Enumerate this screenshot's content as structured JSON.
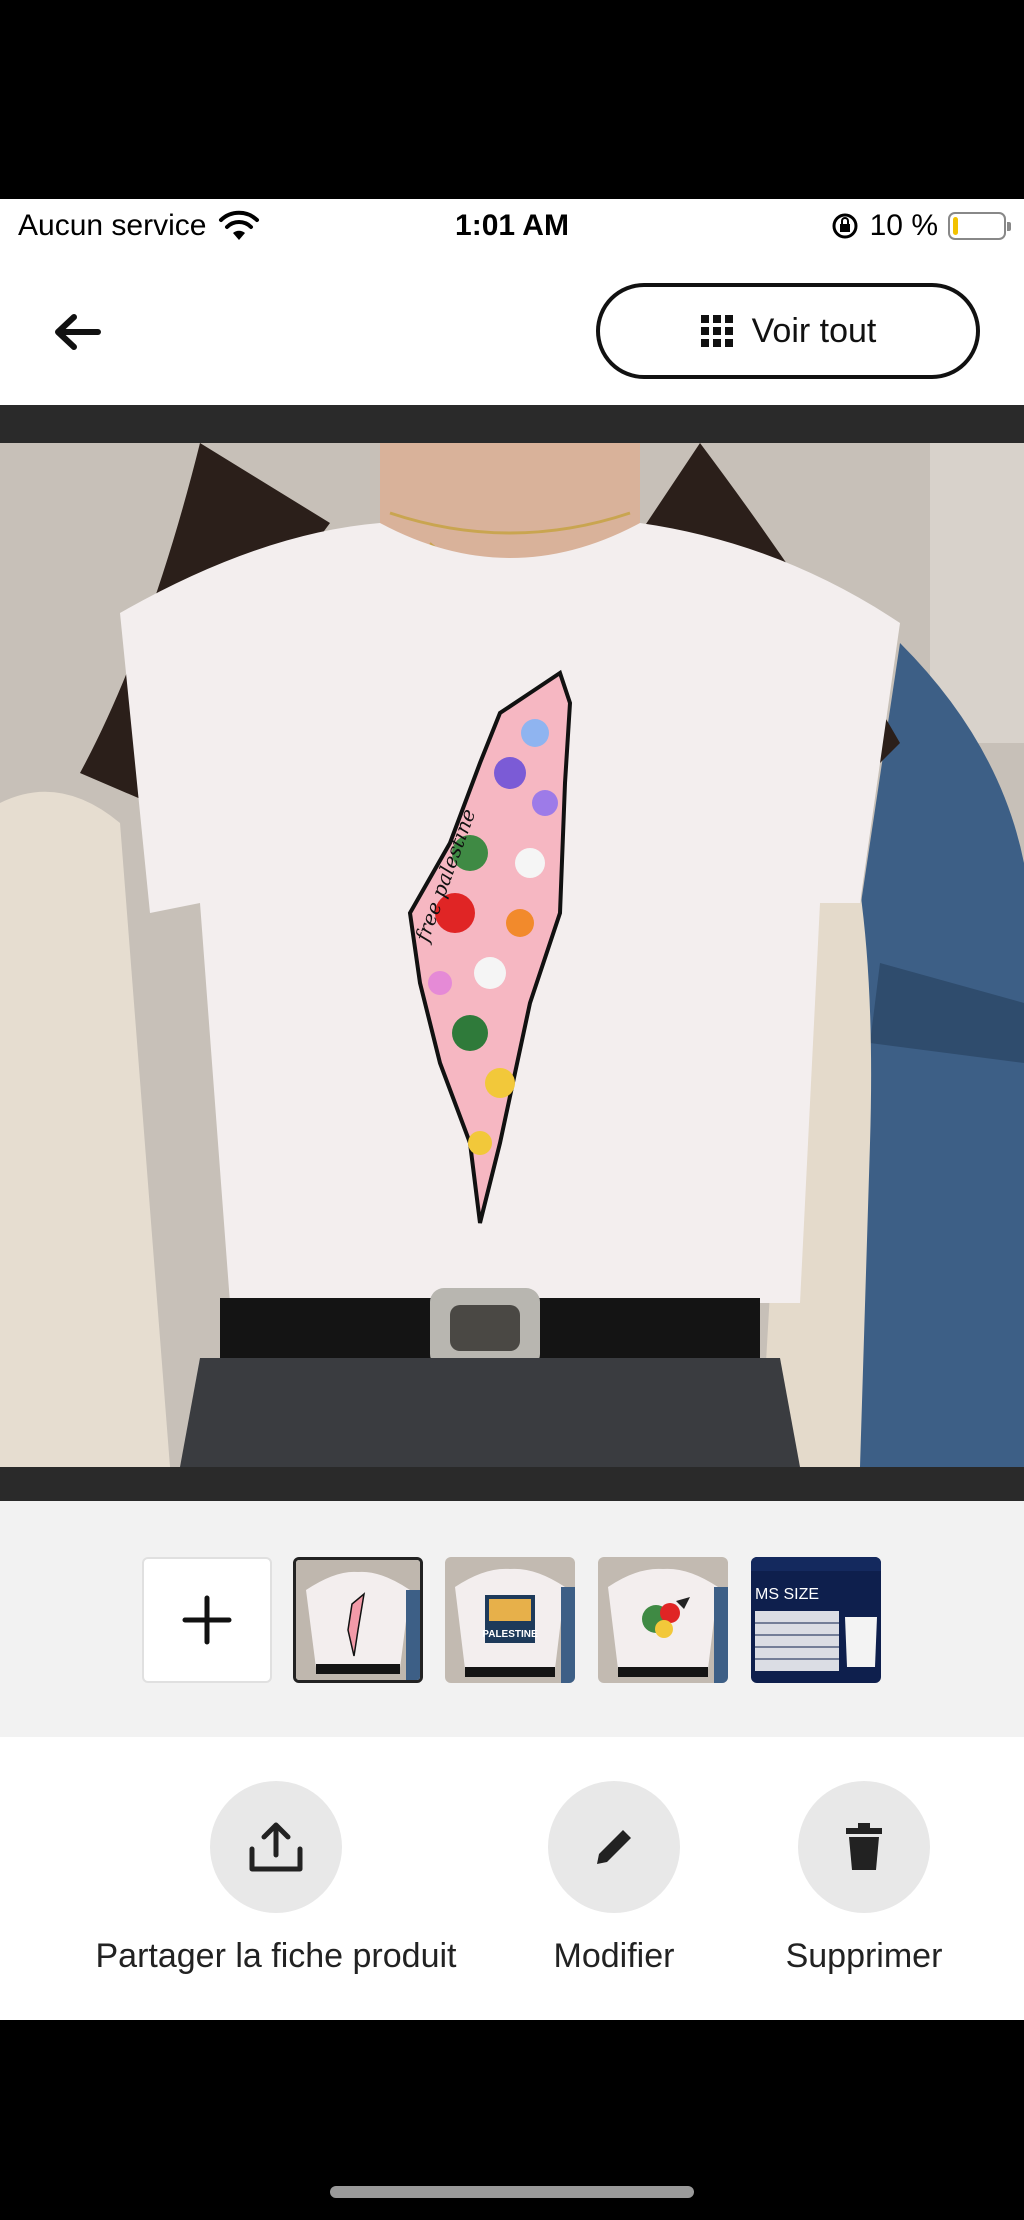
{
  "status_bar": {
    "carrier": "Aucun service",
    "time": "1:01 AM",
    "battery_percent": "10 %",
    "battery_level": 0.1
  },
  "nav": {
    "back_icon": "arrow-left-icon",
    "view_all_label": "Voir tout",
    "view_all_icon": "grid-icon"
  },
  "gallery": {
    "main_image": "white-tshirt-floral-map-photo",
    "print_text": "free palestine",
    "thumbnails": [
      {
        "type": "add",
        "icon": "plus-icon"
      },
      {
        "type": "image",
        "selected": true
      },
      {
        "type": "image",
        "selected": false,
        "text": "PALESTINE"
      },
      {
        "type": "image",
        "selected": false
      },
      {
        "type": "image",
        "selected": false,
        "text": "MS SIZE"
      }
    ]
  },
  "actions": {
    "share_label": "Partager la fiche produit",
    "share_icon": "upload-icon",
    "edit_label": "Modifier",
    "edit_icon": "pencil-icon",
    "delete_label": "Supprimer",
    "delete_icon": "trash-icon"
  },
  "colors": {
    "battery_fill": "#f2c200",
    "action_circle": "#e8e8e8"
  }
}
